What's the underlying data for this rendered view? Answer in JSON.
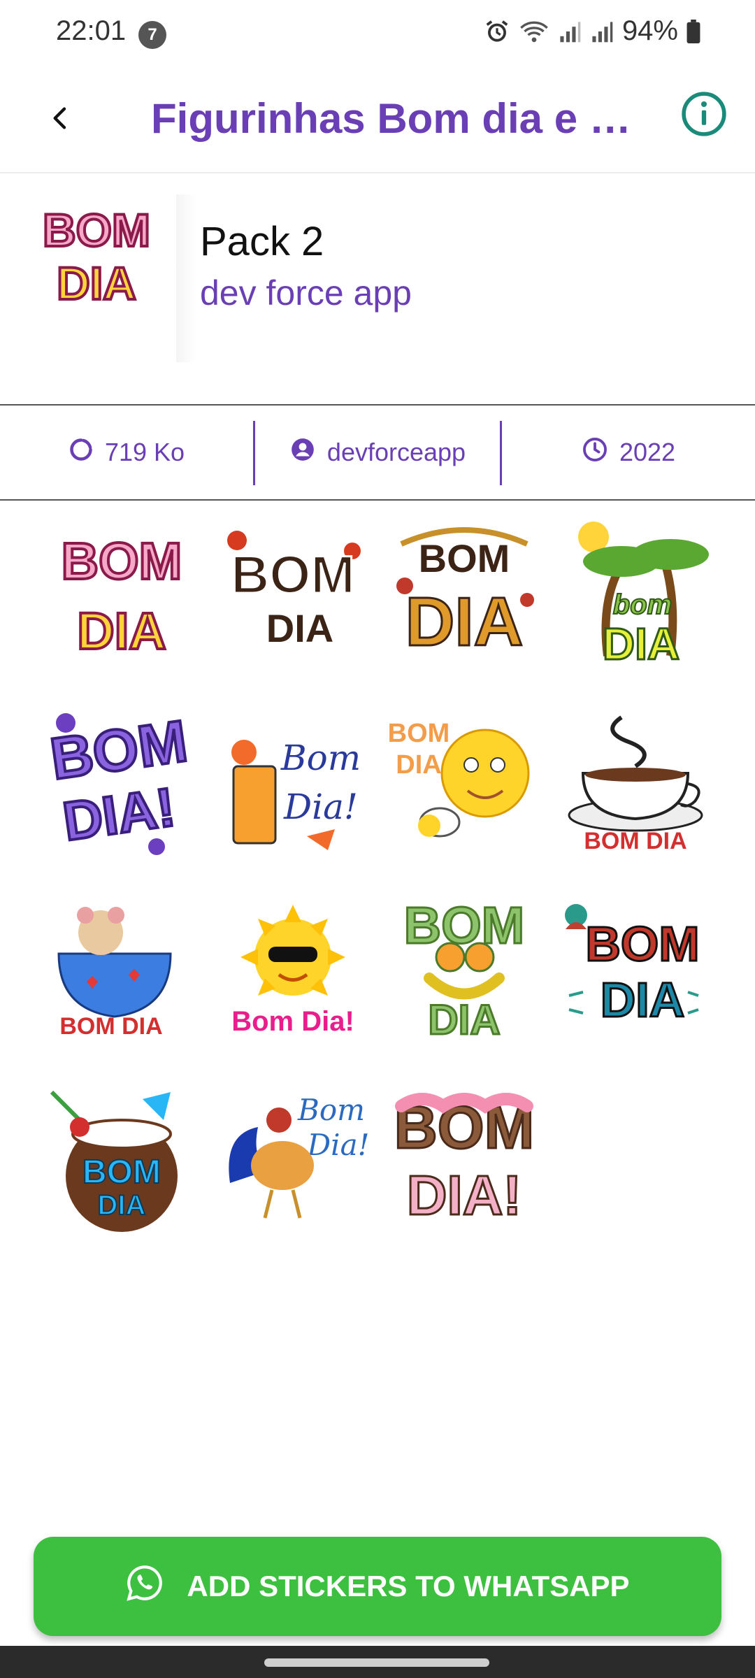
{
  "status_bar": {
    "time": "22:01",
    "notification_count": "7",
    "battery": "94%"
  },
  "app_bar": {
    "title": "Figurinhas Bom dia e Bo..."
  },
  "pack": {
    "name": "Pack 2",
    "publisher": "dev force app",
    "tray_text_1": "BOM",
    "tray_text_2": "DIA"
  },
  "info": {
    "size": "719 Ko",
    "author": "devforceapp",
    "year": "2022"
  },
  "stickers": [
    {
      "l1": "BOM",
      "l2": "DIA"
    },
    {
      "l1": "BOM",
      "l2": "DIA"
    },
    {
      "l1": "BOM",
      "l2": "DIA"
    },
    {
      "l1": "bom",
      "l2": "DIA"
    },
    {
      "l1": "BOM",
      "l2": "DIA!"
    },
    {
      "l1": "Bom",
      "l2": "Dia!"
    },
    {
      "l1": "BOM",
      "l2": "DIA"
    },
    {
      "l1": "",
      "l2": "BOM DIA"
    },
    {
      "l1": "",
      "l2": "BOM DIA"
    },
    {
      "l1": "",
      "l2": "Bom Dia!"
    },
    {
      "l1": "BOM",
      "l2": "DIA"
    },
    {
      "l1": "BOM",
      "l2": "DIA"
    },
    {
      "l1": "BOM",
      "l2": "DIA"
    },
    {
      "l1": "Bom",
      "l2": "Dia!"
    },
    {
      "l1": "BOM",
      "l2": "DIA!"
    }
  ],
  "add_button": {
    "label": "ADD STICKERS TO WHATSAPP"
  },
  "colors": {
    "accent": "#6a3fb5",
    "whatsapp_green": "#3dbf3f",
    "info_teal": "#1a8a7a"
  }
}
